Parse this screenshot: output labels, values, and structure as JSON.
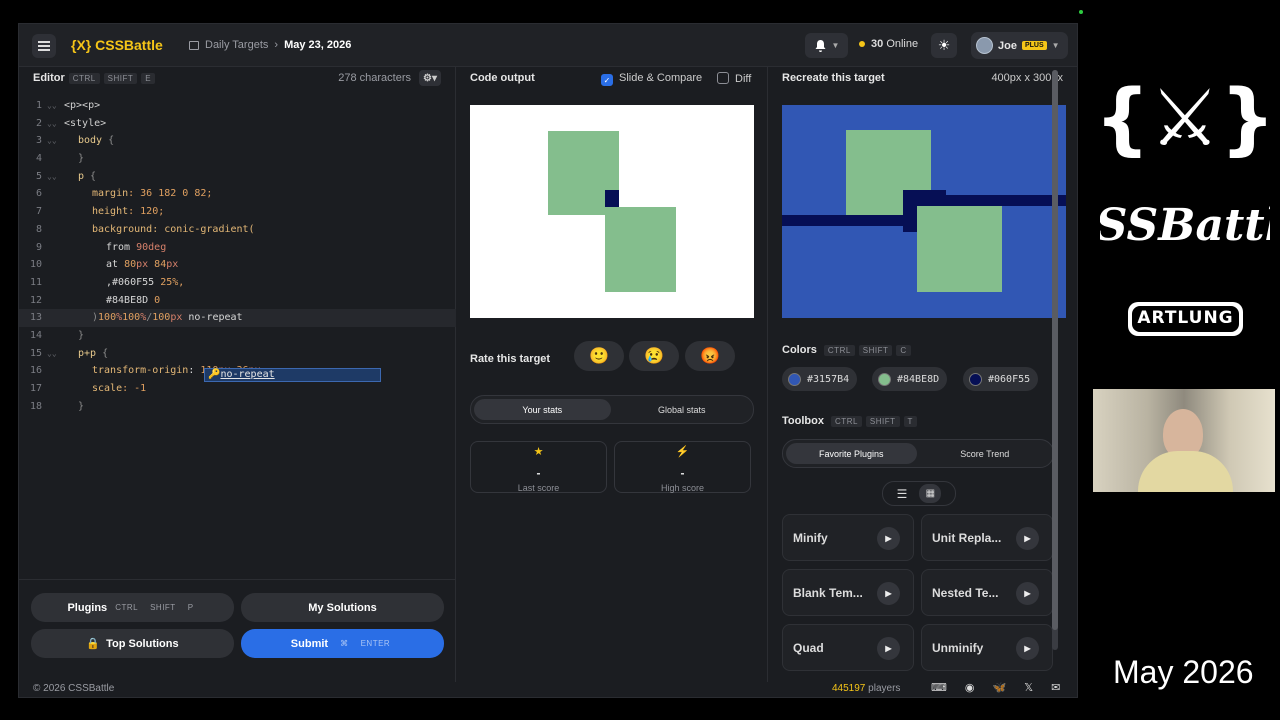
{
  "app": {
    "logo": "{X} CSSBattle",
    "breadcrumb_root": "Daily Targets",
    "breadcrumb_date": "May 23, 2026",
    "online_count": "30",
    "online_label": "Online",
    "user_name": "Joe",
    "user_badge": "PLUS"
  },
  "editor": {
    "title": "Editor",
    "shortcut": [
      "CTRL",
      "SHIFT",
      "E"
    ],
    "char_count": "278 characters",
    "lines": [
      "1",
      "2",
      "3",
      "4",
      "5",
      "6",
      "7",
      "8",
      "9",
      "10",
      "11",
      "12",
      "13",
      "14",
      "15",
      "16",
      "17",
      "18"
    ],
    "code": {
      "l1": "<p><p>",
      "l2": "<style>",
      "l3_sel": "body",
      "l3_brace": " {",
      "l4": "}",
      "l5_sel": "p",
      "l5_brace": " {",
      "l6_prop": "margin",
      "l6_val": ": 36 182 0 82;",
      "l7_prop": "height",
      "l7_val": ": 120;",
      "l8_prop": "background",
      "l8_fn": ": conic-gradient(",
      "l9_a": "from ",
      "l9_b": "90deg",
      "l10_a": "at ",
      "l10_b": "80",
      "l10_c": "px",
      "l10_d": " 84",
      "l10_e": "px",
      "l11_a": ",#060F55 ",
      "l11_b": "25%,",
      "l12_a": "#84BE8D ",
      "l12_b": "0",
      "l13_a": ")",
      "l13_b": "100",
      "l13_c": "%",
      "l13_d": "100",
      "l13_e": "%",
      "l13_f": "/",
      "l13_g": "100",
      "l13_h": "px",
      "l13_i": " no-repeat",
      "l14": "}",
      "l15_sel": "p+p",
      "l15_brace": " {",
      "l16_prop": "transform-origin",
      "l16_a": ": ",
      "l16_b": "110",
      "l16_c": "px",
      "l16_d": " 36",
      "l16_e": "px;",
      "l17_prop": "scale",
      "l17_val": ": -1",
      "l18": "}"
    },
    "autocomplete": "no-repeat",
    "btn_plugins": "Plugins",
    "plugins_shortcut": [
      "CTRL",
      "SHIFT",
      "P"
    ],
    "btn_my_solutions": "My Solutions",
    "btn_top_solutions": "Top Solutions",
    "btn_submit": "Submit",
    "submit_shortcut": [
      "⌘",
      "ENTER"
    ]
  },
  "output": {
    "title": "Code output",
    "slide_compare": "Slide & Compare",
    "diff": "Diff",
    "rate_label": "Rate this target",
    "emojis": [
      "🙂",
      "😢",
      "😡"
    ],
    "tab_your": "Your stats",
    "tab_global": "Global stats",
    "last_score_value": "-",
    "last_score_label": "Last score",
    "high_score_value": "-",
    "high_score_label": "High score"
  },
  "target": {
    "title": "Recreate this target",
    "size": "400px x 300px",
    "colors_label": "Colors",
    "colors_shortcut": [
      "CTRL",
      "SHIFT",
      "C"
    ],
    "colors": [
      {
        "hex": "#3157B4",
        "label": "#3157B4"
      },
      {
        "hex": "#84BE8D",
        "label": "#84BE8D"
      },
      {
        "hex": "#060F55",
        "label": "#060F55"
      }
    ],
    "toolbox_label": "Toolbox",
    "toolbox_shortcut": [
      "CTRL",
      "SHIFT",
      "T"
    ],
    "tab_fav": "Favorite Plugins",
    "tab_trend": "Score Trend",
    "plugins": [
      "Minify",
      "Unit Repla...",
      "Blank Tem...",
      "Nested Te...",
      "Quad",
      "Unminify"
    ]
  },
  "footer": {
    "copyright": "© 2026 CSSBattle",
    "players_count": "445197",
    "players_label": "players"
  },
  "overlay": {
    "brand_text": "ARTLUNG",
    "stamp": "May 2026"
  },
  "palette": {
    "accent_yellow": "#f5c518",
    "submit_blue": "#2a6ee6",
    "bg_blue": "#3157B4",
    "green": "#84BE8D",
    "navy": "#060F55"
  }
}
